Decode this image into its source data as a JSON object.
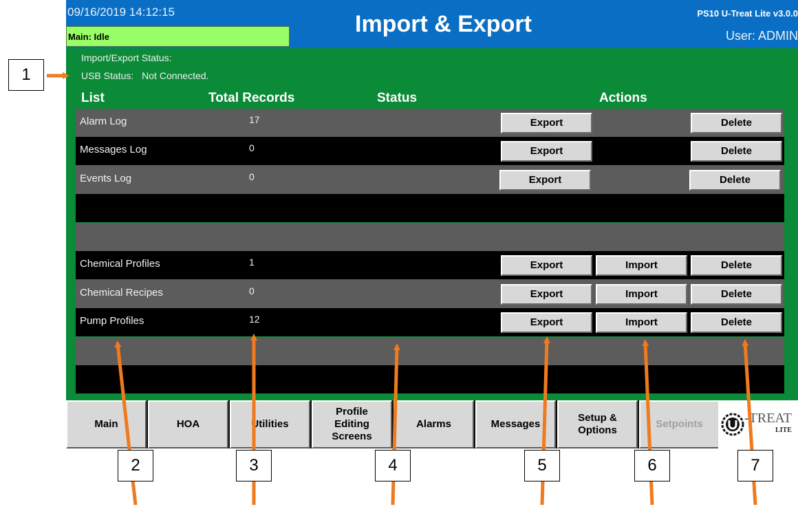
{
  "header": {
    "datetime": "09/16/2019 14:12:15",
    "state": "Main: Idle",
    "title": "Import & Export",
    "version": "PS10 U-Treat Lite v3.0.0",
    "user": "User: ADMIN"
  },
  "status": {
    "import_export_label": "Import/Export Status:",
    "usb_label": "USB Status:",
    "usb_value": "Not Connected."
  },
  "columns": {
    "list": "List",
    "total_records": "Total Records",
    "status": "Status",
    "actions": "Actions"
  },
  "rows": [
    {
      "name": "Alarm Log",
      "count": "17",
      "status": "",
      "export": "Export",
      "import": "",
      "delete": "Delete"
    },
    {
      "name": "Messages Log",
      "count": "0",
      "status": "",
      "export": "Export",
      "import": "",
      "delete": "Delete"
    },
    {
      "name": "Events Log",
      "count": "0",
      "status": "",
      "export": "Export",
      "import": "",
      "delete": "Delete"
    },
    {
      "name": "",
      "count": "",
      "status": "",
      "export": "",
      "import": "",
      "delete": ""
    },
    {
      "name": "",
      "count": "",
      "status": "",
      "export": "",
      "import": "",
      "delete": ""
    },
    {
      "name": "Chemical Profiles",
      "count": "1",
      "status": "",
      "export": "Export",
      "import": "Import",
      "delete": "Delete"
    },
    {
      "name": "Chemical Recipes",
      "count": "0",
      "status": "",
      "export": "Export",
      "import": "Import",
      "delete": "Delete"
    },
    {
      "name": "Pump Profiles",
      "count": "12",
      "status": "",
      "export": "Export",
      "import": "Import",
      "delete": "Delete"
    },
    {
      "name": "",
      "count": "",
      "status": "",
      "export": "",
      "import": "",
      "delete": ""
    },
    {
      "name": "",
      "count": "",
      "status": "",
      "export": "",
      "import": "",
      "delete": ""
    }
  ],
  "nav": [
    {
      "label": "Main",
      "disabled": false
    },
    {
      "label": "HOA",
      "disabled": false
    },
    {
      "label": "Utilities",
      "disabled": false
    },
    {
      "label": "Profile\nEditing\nScreens",
      "disabled": false
    },
    {
      "label": "Alarms",
      "disabled": false
    },
    {
      "label": "Messages",
      "disabled": false
    },
    {
      "label": "Setup &\nOptions",
      "disabled": false
    },
    {
      "label": "Setpoints",
      "disabled": true
    }
  ],
  "logo": {
    "text": "-TREAT",
    "sub": "LITE"
  },
  "callouts": [
    "1",
    "2",
    "3",
    "4",
    "5",
    "6",
    "7"
  ],
  "colors": {
    "header_blue": "#0a6fc4",
    "panel_green": "#0b8a37",
    "state_green": "#99ff66",
    "row_gray": "#5c5c5c",
    "button_gray": "#d8d8d8",
    "callout_arrow": "#f07a1e"
  }
}
